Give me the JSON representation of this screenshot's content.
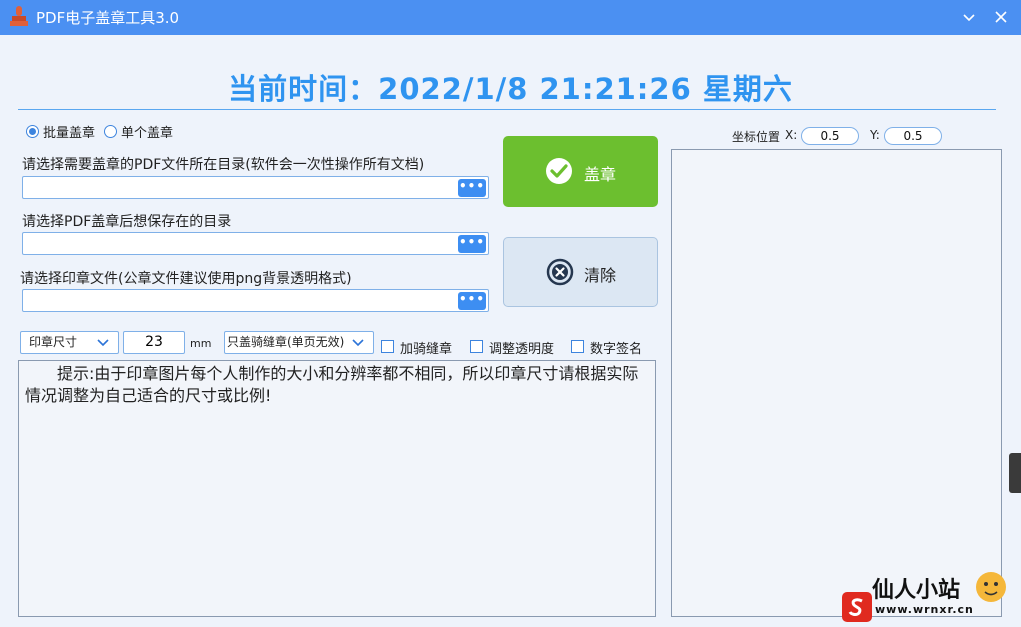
{
  "window": {
    "title": "PDF电子盖章工具3.0",
    "minimize_icon": "chevron-down-icon",
    "close_icon": "close-icon"
  },
  "time_display": "当前时间：2022/1/8  21:21:26   星期六",
  "mode": {
    "batch_label": "批量盖章",
    "single_label": "单个盖章",
    "selected": "batch"
  },
  "fields": {
    "source_label": "请选择需要盖章的PDF文件所在目录(软件会一次性操作所有文档)",
    "source_value": "",
    "output_label": "请选择PDF盖章后想保存在的目录",
    "output_value": "",
    "stamp_label": "请选择印章文件(公章文件建议使用png背景透明格式)",
    "stamp_value": "",
    "browse_glyph": "•••"
  },
  "actions": {
    "stamp_label": "盖章",
    "clear_label": "清除"
  },
  "coords": {
    "label": "坐标位置",
    "x_label": "X:",
    "x_value": "0.5",
    "y_label": "Y:",
    "y_value": "0.5"
  },
  "options": {
    "size_select": "印章尺寸",
    "size_value": "23",
    "unit": "mm",
    "seam_select": "只盖骑缝章(单页无效)",
    "seam_check": "加骑缝章",
    "opacity_check": "调整透明度",
    "signature_check": "数字签名"
  },
  "hint": "提示:由于印章图片每个人制作的大小和分辨率都不相同，所以印章尺寸请根据实际情况调整为自己适合的尺寸或比例!",
  "watermark": {
    "title": "仙人小站",
    "url": "www.wrnxr.cn"
  },
  "colors": {
    "titlebar": "#4b90f2",
    "accent": "#2f94f0",
    "stamp_button": "#6cbf2f"
  }
}
